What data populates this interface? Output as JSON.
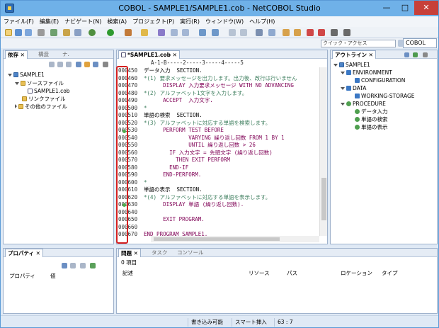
{
  "window": {
    "title": "COBOL - SAMPLE1/SAMPLE1.cob - NetCOBOL Studio"
  },
  "menu": [
    "ファイル(F)",
    "編集(E)",
    "ナビゲート(N)",
    "検索(A)",
    "プロジェクト(P)",
    "実行(R)",
    "ウィンドウ(W)",
    "ヘルプ(H)"
  ],
  "quick_access": {
    "placeholder": "クイック・アクセス"
  },
  "perspective": {
    "label": "COBOL"
  },
  "left_panel": {
    "tabs": [
      "依存",
      "構造",
      "ナ."
    ],
    "tree": [
      {
        "label": "SAMPLE1",
        "icon": "project-icon"
      },
      {
        "label": "ソースファイル",
        "icon": "folder-icon"
      },
      {
        "label": "SAMPLE1.cob",
        "icon": "file-icon"
      },
      {
        "label": "リンクファイル",
        "icon": "folder-icon"
      },
      {
        "label": "その他のファイル",
        "icon": "folder-icon"
      }
    ]
  },
  "editor": {
    "tab": "*SAMPLE1.cob",
    "ruler": "A-1-B-----2-----3-----4-----5",
    "lines": [
      {
        "num": "000450",
        "text": "データ入力  SECTION.",
        "style": "code"
      },
      {
        "num": "000460",
        "text": "*(1) 要求メッセージを出力します。出力後、改行は行いません",
        "style": "cm"
      },
      {
        "num": "000470",
        "text": "      DISPLAY 入力要求メッセージ WITH NO ADVANCING",
        "style": "kw"
      },
      {
        "num": "000480",
        "text": "*(2) アルファベット1文字を入力します。",
        "style": "cm"
      },
      {
        "num": "000490",
        "text": "      ACCEPT  入力文字.",
        "style": "kw"
      },
      {
        "num": "000500",
        "text": "*",
        "style": "cm"
      },
      {
        "num": "000510",
        "text": "単語の検索  SECTION.",
        "style": "code"
      },
      {
        "num": "000520",
        "text": "*(3) アルファベットに対応する単語を検索します。",
        "style": "cm"
      },
      {
        "num": "000530",
        "text": "      PERFORM TEST BEFORE",
        "style": "kw"
      },
      {
        "num": "000540",
        "text": "              VARYING 繰り返し回数 FROM 1 BY 1",
        "style": "kw"
      },
      {
        "num": "000550",
        "text": "              UNTIL 繰り返し回数 > 26",
        "style": "kw"
      },
      {
        "num": "000560",
        "text": "        IF 入力文字 = 先頭文字 (繰り返し回数)",
        "style": "kw"
      },
      {
        "num": "000570",
        "text": "          THEN EXIT PERFORM",
        "style": "kw"
      },
      {
        "num": "000580",
        "text": "        END-IF",
        "style": "kw"
      },
      {
        "num": "000590",
        "text": "      END-PERFORM.",
        "style": "kw"
      },
      {
        "num": "000600",
        "text": "*",
        "style": "cm"
      },
      {
        "num": "000610",
        "text": "単語の表示  SECTION.",
        "style": "code"
      },
      {
        "num": "000620",
        "text": "*(4) アルファベットに対応する単語を表示します。",
        "style": "cm"
      },
      {
        "num": "000630",
        "text": "      DISPLAY 単語 (繰り返し回数).",
        "style": "kw"
      },
      {
        "num": "000640",
        "text": "",
        "style": "code"
      },
      {
        "num": "000650",
        "text": "      EXIT PROGRAM.",
        "style": "kw"
      },
      {
        "num": "000660",
        "text": "",
        "style": "code"
      },
      {
        "num": "000670",
        "text": "END PROGRAM SAMPLE1.",
        "style": "kw"
      }
    ]
  },
  "outline": {
    "tab": "アウトライン",
    "tree": [
      {
        "label": "SAMPLE1",
        "level": 0
      },
      {
        "label": "ENVIRONMENT",
        "level": 1
      },
      {
        "label": "CONFIGURATION",
        "level": 2
      },
      {
        "label": "DATA",
        "level": 1
      },
      {
        "label": "WORKING-STORAGE",
        "level": 2
      },
      {
        "label": "PROCEDURE",
        "level": 1
      },
      {
        "label": "データ入力",
        "level": 2
      },
      {
        "label": "単語の検索",
        "level": 2
      },
      {
        "label": "単語の表示",
        "level": 2
      }
    ]
  },
  "properties": {
    "tab": "プロパティ",
    "col_property": "プロパティ",
    "col_value": "値"
  },
  "problems": {
    "tabs": [
      "問題",
      "タスク",
      "コンソール"
    ],
    "count": "0 項目",
    "columns": [
      "記述",
      "リソース",
      "パス",
      "ロケーション",
      "タイプ"
    ]
  },
  "status": {
    "writable": "書き込み可能",
    "insert": "スマート挿入",
    "position": "63 : 7"
  }
}
